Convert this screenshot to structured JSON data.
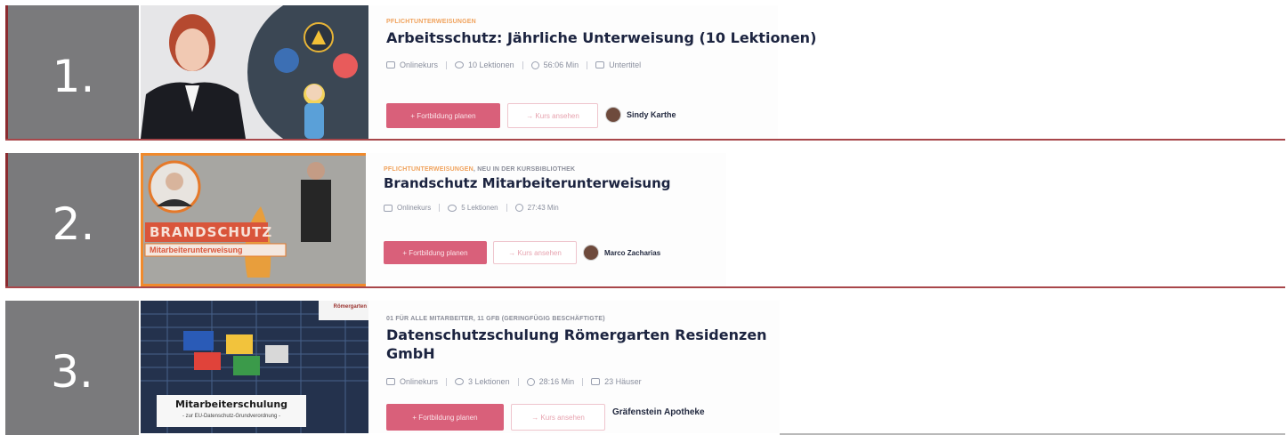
{
  "courses": [
    {
      "rank": "1.",
      "kicker_orange": "PFLICHTUNTERWEISUNGEN",
      "kicker_grey": "",
      "title_lines": [
        "Arbeitsschutz: Jährliche Unterweisung (10 Lektionen)"
      ],
      "meta": [
        {
          "icon": "book-icon",
          "text": "Onlinekurs"
        },
        {
          "icon": "eye-icon",
          "text": "10 Lektionen"
        },
        {
          "icon": "clock-icon",
          "text": "56:06 Min"
        },
        {
          "icon": "subtitles-icon",
          "text": "Untertitel"
        }
      ],
      "primary_button": "+ Fortbildung planen",
      "secondary_button": "→ Kurs ansehen",
      "author": "Sindy Karthe"
    },
    {
      "rank": "2.",
      "kicker_orange": "PFLICHTUNTERWEISUNGEN",
      "kicker_grey": ", NEU IN DER KURSBIBLIOTHEK",
      "title_lines": [
        "Brandschutz Mitarbeiterunterweisung"
      ],
      "meta": [
        {
          "icon": "book-icon",
          "text": "Onlinekurs"
        },
        {
          "icon": "eye-icon",
          "text": "5 Lektionen"
        },
        {
          "icon": "clock-icon",
          "text": "27:43 Min"
        }
      ],
      "primary_button": "+ Fortbildung planen",
      "secondary_button": "→ Kurs ansehen",
      "author": "Marco Zacharias",
      "thumb_title": "BRANDSCHUTZ",
      "thumb_subtitle": "Mitarbeiterunterweisung"
    },
    {
      "rank": "3.",
      "kicker_orange": "",
      "kicker_grey": "01 FÜR ALLE MITARBEITER, 11 GFB (GERINGFÜGIG BESCHÄFTIGTE)",
      "title_lines": [
        "Datenschutzschulung Römergarten Residenzen",
        "GmbH"
      ],
      "meta": [
        {
          "icon": "book-icon",
          "text": "Onlinekurs"
        },
        {
          "icon": "eye-icon",
          "text": "3 Lektionen"
        },
        {
          "icon": "clock-icon",
          "text": "28:16 Min"
        },
        {
          "icon": "building-icon",
          "text": "23 Häuser"
        }
      ],
      "primary_button": "+ Fortbildung planen",
      "secondary_button": "→ Kurs ansehen",
      "author": "Gräfenstein Apotheke",
      "thumb_logo": "Römergarten",
      "thumb_title": "Mitarbeiterschulung",
      "thumb_subtitle": "- zur EU-Datenschutz-Grundverordnung -"
    }
  ],
  "colors": {
    "rank_bg": "#7a7a7c",
    "divider": "#a8464a",
    "primary_button": "#d9607a",
    "title": "#1c2440",
    "kicker": "#f0a25c"
  }
}
